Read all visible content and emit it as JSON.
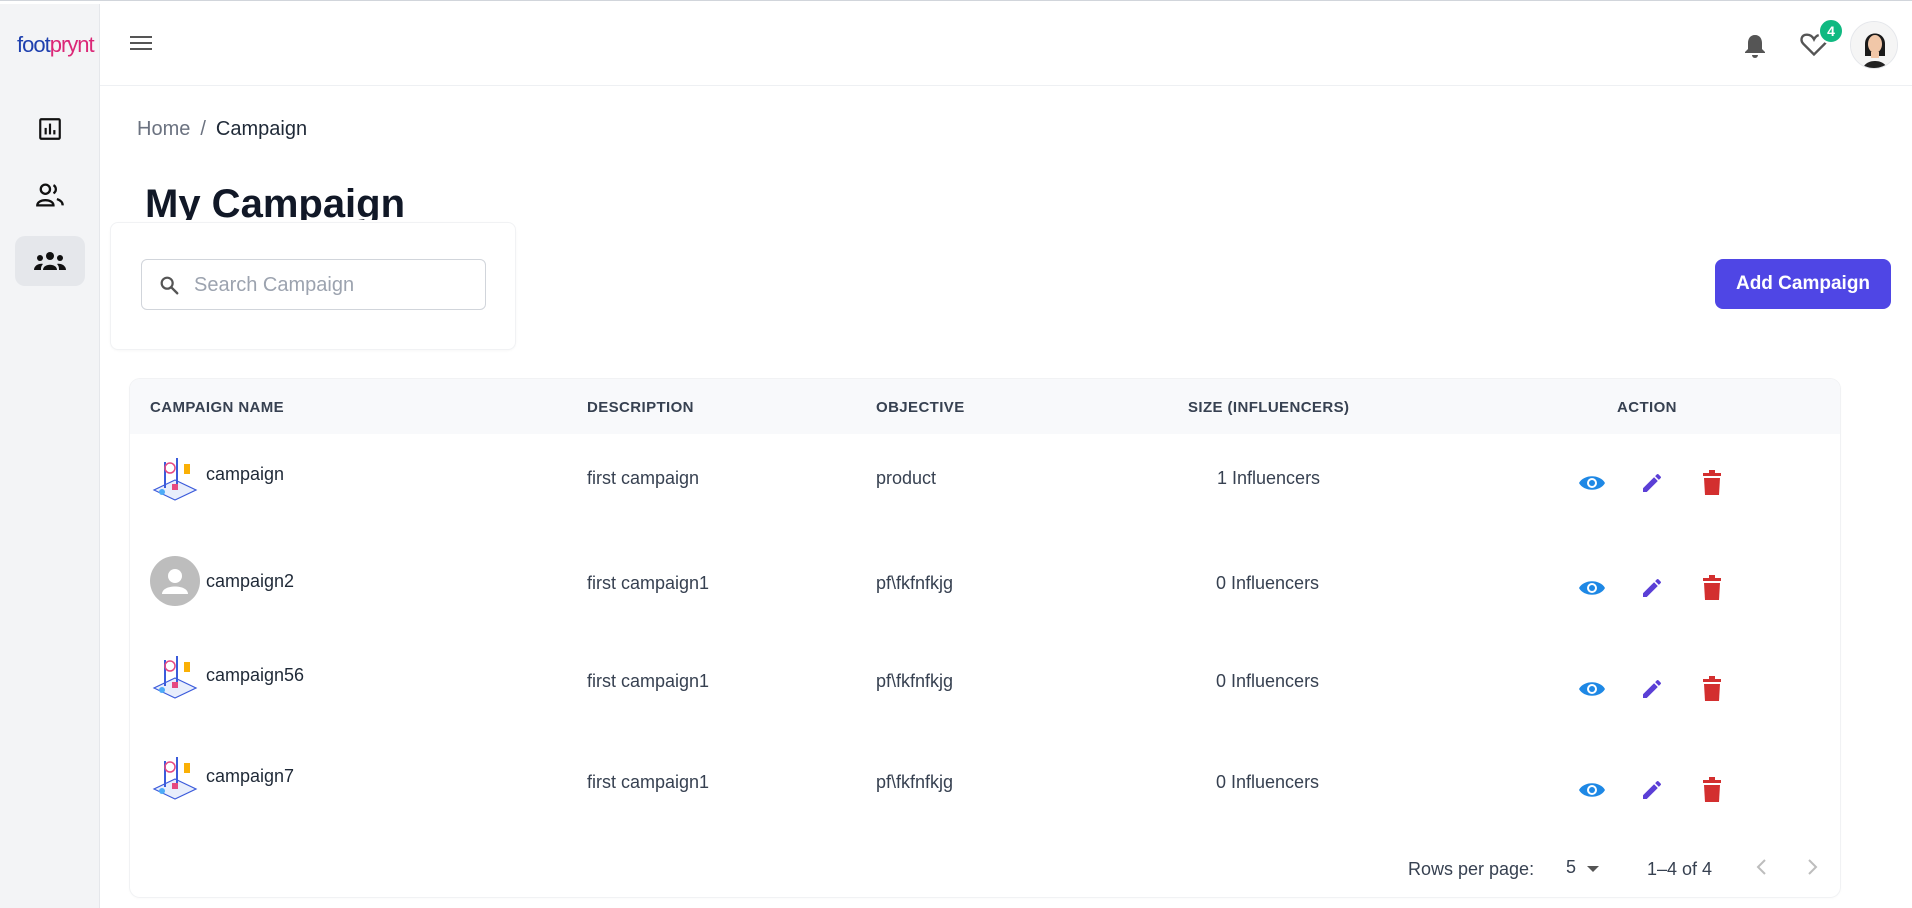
{
  "sidebar": {
    "logo": {
      "part1": "foot",
      "part2": "prynt"
    },
    "items": [
      {
        "icon": "analytics-icon"
      },
      {
        "icon": "users-icon"
      },
      {
        "icon": "groups-icon",
        "active": true
      }
    ]
  },
  "header": {
    "notification_count": "4"
  },
  "breadcrumb": {
    "home": "Home",
    "separator": "/",
    "current": "Campaign"
  },
  "page": {
    "title": "My Campaign"
  },
  "search": {
    "placeholder": "Search Campaign",
    "value": ""
  },
  "toolbar": {
    "add_label": "Add Campaign"
  },
  "table": {
    "columns": [
      "CAMPAIGN NAME",
      "DESCRIPTION",
      "OBJECTIVE",
      "SIZE (INFLUENCERS)",
      "ACTION"
    ],
    "rows": [
      {
        "name": "campaign",
        "description": "first campaign",
        "objective": "product",
        "size": "1 Influencers",
        "thumb": "illustration"
      },
      {
        "name": "campaign2",
        "description": "first campaign1",
        "objective": "pf\\fkfnfkjg",
        "size": "0 Influencers",
        "thumb": "placeholder"
      },
      {
        "name": "campaign56",
        "description": "first campaign1",
        "objective": "pf\\fkfnfkjg",
        "size": "0 Influencers",
        "thumb": "illustration"
      },
      {
        "name": "campaign7",
        "description": "first campaign1",
        "objective": "pf\\fkfnfkjg",
        "size": "0 Influencers",
        "thumb": "illustration"
      }
    ]
  },
  "pagination": {
    "rows_per_page_label": "Rows per page:",
    "rows_per_page": "5",
    "range": "1–4 of 4"
  },
  "colors": {
    "primary": "#4f46e5",
    "view": "#1e88e5",
    "edit": "#5b3fd6",
    "delete": "#d32f2f",
    "badge": "#10b981"
  }
}
